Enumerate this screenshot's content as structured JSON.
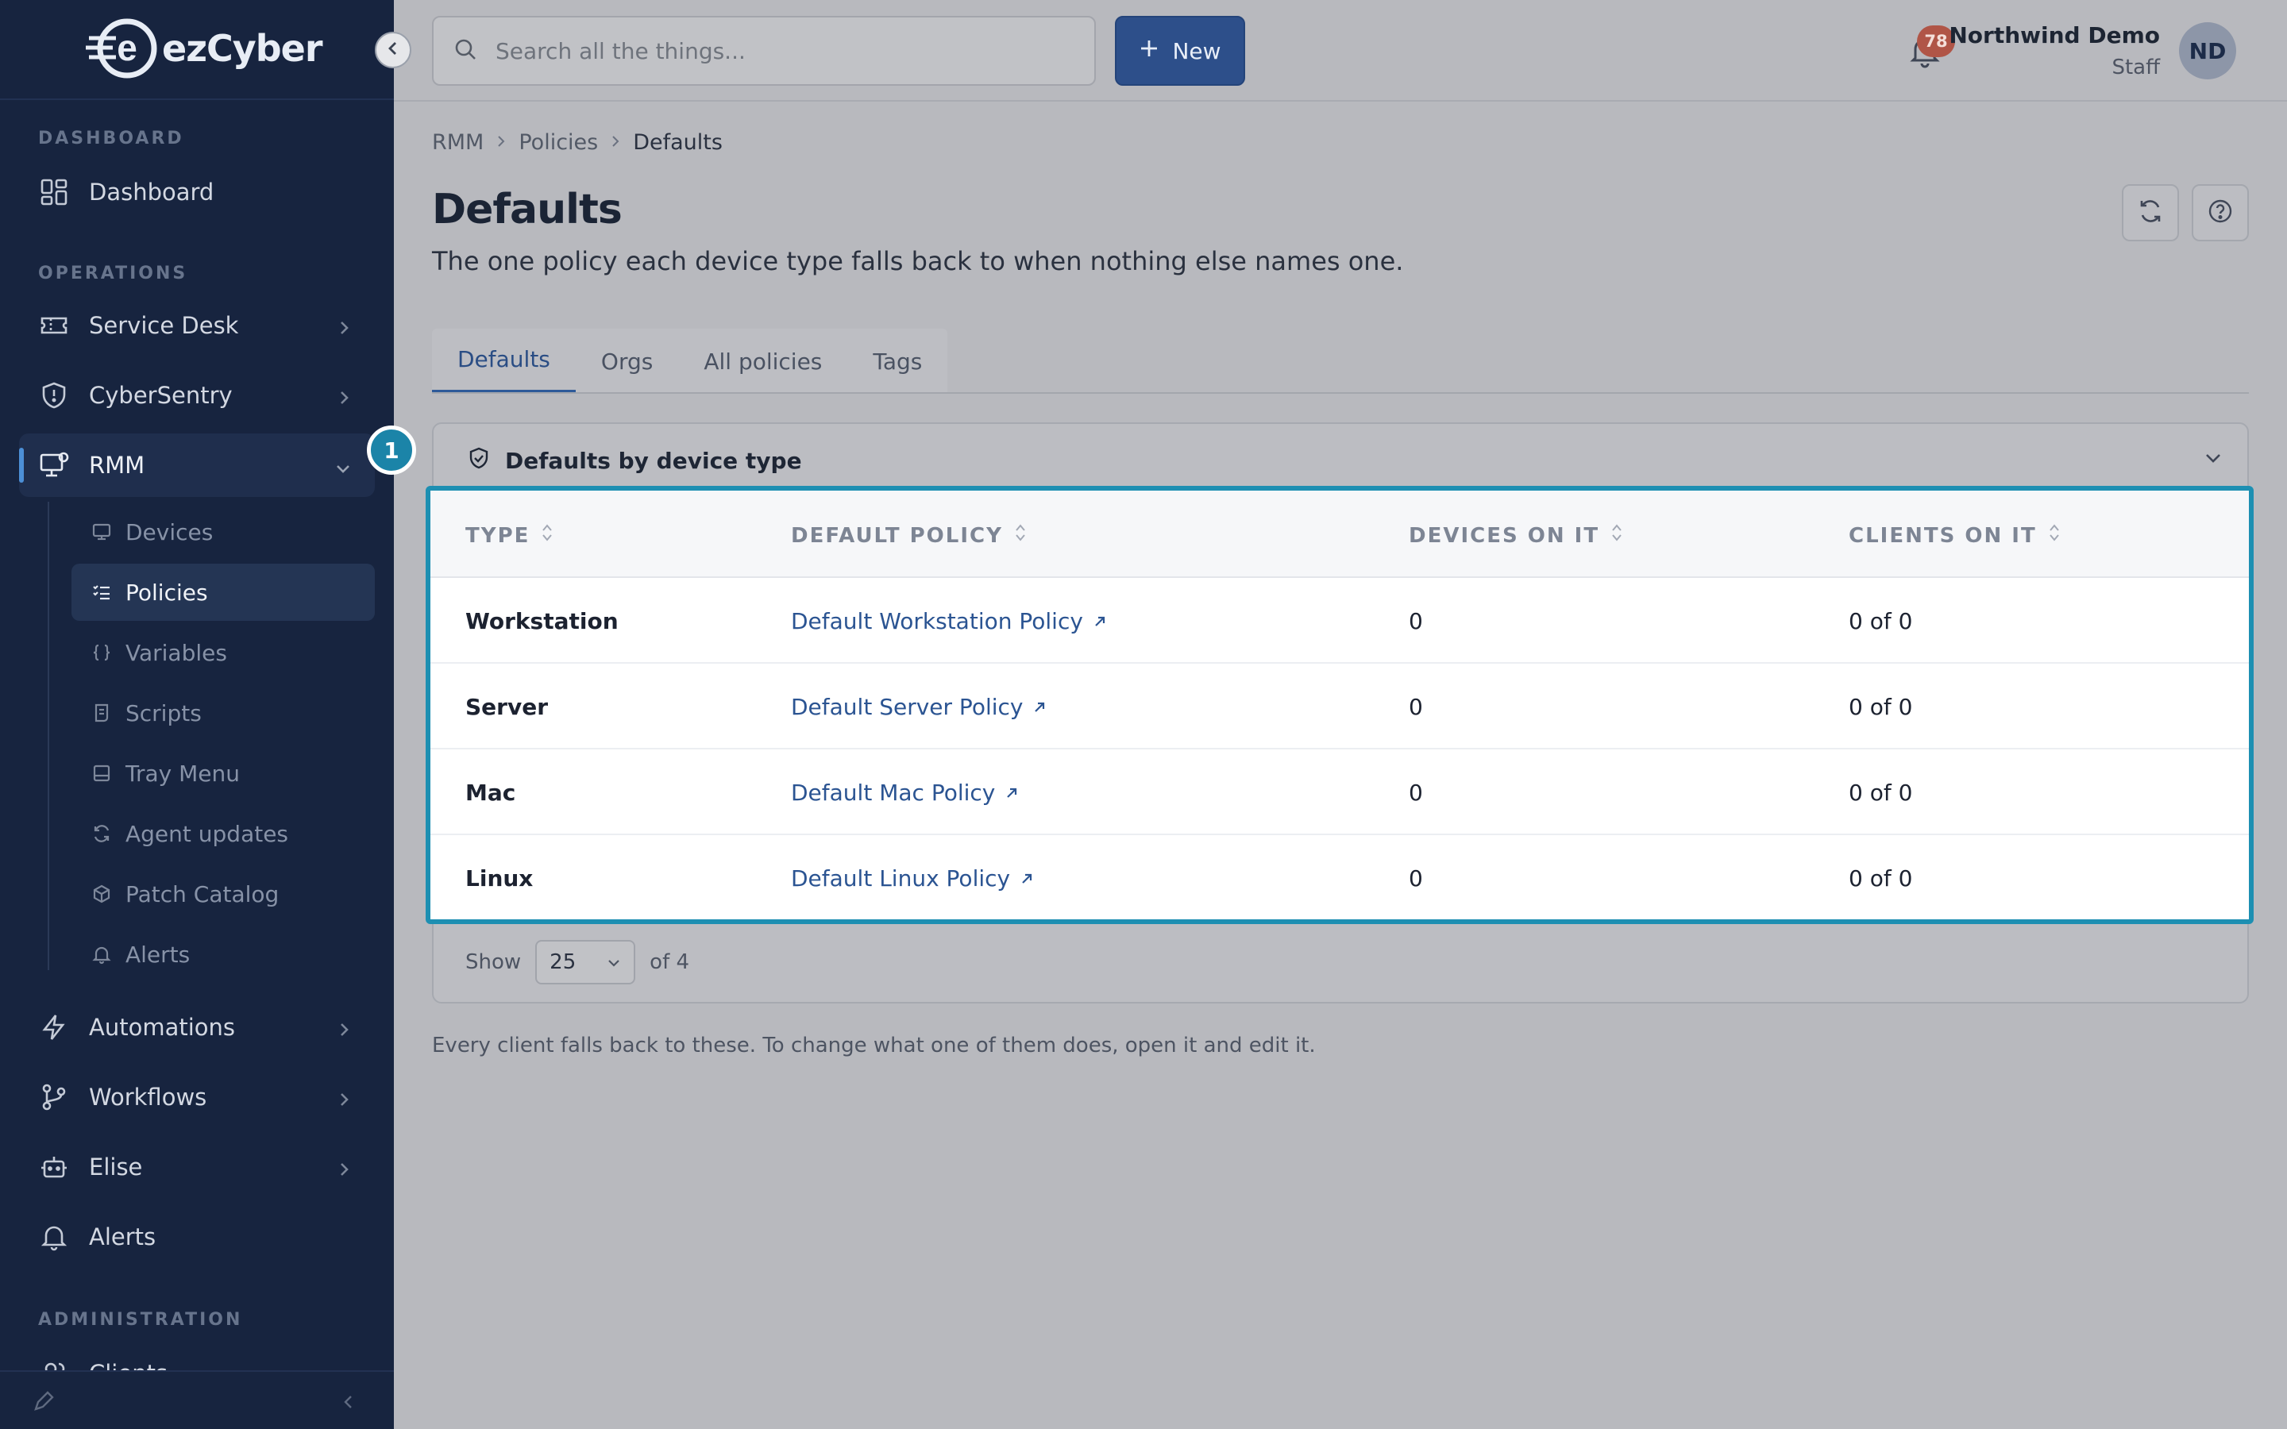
{
  "brand": {
    "name": "ezCyber",
    "logo_letter": "e"
  },
  "sidebar": {
    "sections": {
      "dashboard": "DASHBOARD",
      "operations": "OPERATIONS",
      "administration": "ADMINISTRATION"
    },
    "items": {
      "dashboard": "Dashboard",
      "service_desk": "Service Desk",
      "cybersentry": "CyberSentry",
      "rmm": "RMM",
      "automations": "Automations",
      "workflows": "Workflows",
      "elise": "Elise",
      "alerts": "Alerts",
      "clients": "Clients"
    },
    "rmm_sub": {
      "devices": "Devices",
      "policies": "Policies",
      "variables": "Variables",
      "scripts": "Scripts",
      "tray_menu": "Tray Menu",
      "agent_updates": "Agent updates",
      "patch_catalog": "Patch Catalog",
      "alerts": "Alerts"
    }
  },
  "topbar": {
    "search_placeholder": "Search all the things...",
    "new_label": "New",
    "notifications_count": "78",
    "user_name": "Northwind Demo",
    "user_role": "Staff",
    "user_initials": "ND"
  },
  "breadcrumb": [
    "RMM",
    "Policies",
    "Defaults"
  ],
  "page": {
    "title": "Defaults",
    "subtitle": "The one policy each device type falls back to when nothing else names one."
  },
  "tabs": [
    "Defaults",
    "Orgs",
    "All policies",
    "Tags"
  ],
  "card": {
    "title": "Defaults by device type"
  },
  "table": {
    "headers": [
      "TYPE",
      "DEFAULT POLICY",
      "DEVICES ON IT",
      "CLIENTS ON IT"
    ],
    "rows": [
      {
        "type": "Workstation",
        "policy": "Default Workstation Policy",
        "devices": "0",
        "clients": "0 of 0"
      },
      {
        "type": "Server",
        "policy": "Default Server Policy",
        "devices": "0",
        "clients": "0 of 0"
      },
      {
        "type": "Mac",
        "policy": "Default Mac Policy",
        "devices": "0",
        "clients": "0 of 0"
      },
      {
        "type": "Linux",
        "policy": "Default Linux Policy",
        "devices": "0",
        "clients": "0 of 0"
      }
    ]
  },
  "pager": {
    "show_label": "Show",
    "page_size": "25",
    "total_label": "of 4"
  },
  "footnote": "Every client falls back to these. To change what one of them does, open it and edit it.",
  "callout": {
    "number": "1"
  },
  "colors": {
    "accent": "#2d4f8a",
    "highlight": "#1d8fb2",
    "sidebar": "#17243f",
    "badge": "#b05547"
  }
}
